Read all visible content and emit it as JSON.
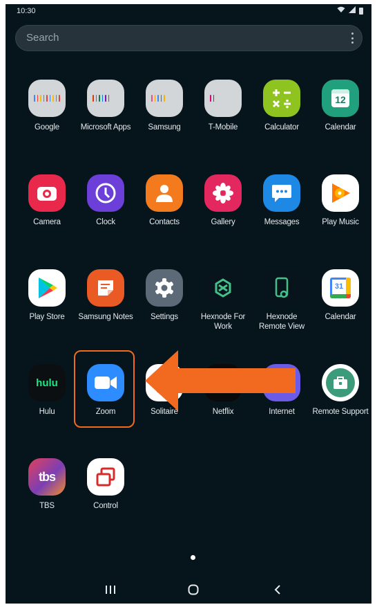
{
  "status": {
    "time": "10:30"
  },
  "search": {
    "placeholder": "Search"
  },
  "apps": [
    {
      "label": "Google",
      "icon": "google-folder-icon"
    },
    {
      "label": "Microsoft Apps",
      "icon": "microsoft-folder-icon"
    },
    {
      "label": "Samsung",
      "icon": "samsung-folder-icon"
    },
    {
      "label": "T-Mobile",
      "icon": "tmobile-folder-icon"
    },
    {
      "label": "Calculator",
      "icon": "calculator-icon"
    },
    {
      "label": "Calendar",
      "icon": "calendar-icon",
      "badge": "12"
    },
    {
      "label": "Camera",
      "icon": "camera-icon"
    },
    {
      "label": "Clock",
      "icon": "clock-icon"
    },
    {
      "label": "Contacts",
      "icon": "contacts-icon"
    },
    {
      "label": "Gallery",
      "icon": "gallery-icon"
    },
    {
      "label": "Messages",
      "icon": "messages-icon"
    },
    {
      "label": "Play Music",
      "icon": "play-music-icon"
    },
    {
      "label": "Play Store",
      "icon": "play-store-icon"
    },
    {
      "label": "Samsung Notes",
      "icon": "samsung-notes-icon"
    },
    {
      "label": "Settings",
      "icon": "settings-icon"
    },
    {
      "label": "Hexnode For Work",
      "icon": "hexnode-for-work-icon"
    },
    {
      "label": "Hexnode Remote View",
      "icon": "hexnode-remote-view-icon"
    },
    {
      "label": "Calendar",
      "icon": "google-calendar-icon",
      "badge": "31"
    },
    {
      "label": "Hulu",
      "icon": "hulu-icon",
      "logo": "hulu"
    },
    {
      "label": "Zoom",
      "icon": "zoom-icon"
    },
    {
      "label": "Solitaire",
      "icon": "solitaire-icon"
    },
    {
      "label": "Netflix",
      "icon": "netflix-icon"
    },
    {
      "label": "Internet",
      "icon": "internet-icon"
    },
    {
      "label": "Remote Support",
      "icon": "remote-support-icon"
    },
    {
      "label": "TBS",
      "icon": "tbs-icon",
      "logo": "tbs"
    },
    {
      "label": "Control",
      "icon": "control-icon"
    }
  ],
  "annotation": {
    "color": "#f26a1f"
  }
}
